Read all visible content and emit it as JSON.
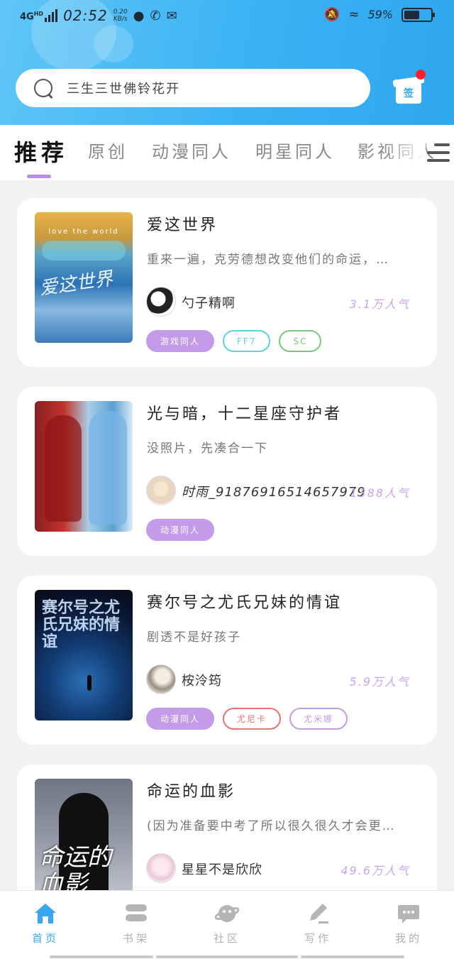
{
  "status_bar": {
    "network": "4G",
    "network_sup": "HD",
    "time": "02:52",
    "speed_value": "0.20",
    "speed_unit": "KB/s",
    "battery": "59%",
    "battery_level": 0.59
  },
  "search": {
    "placeholder": "三生三世佛铃花开"
  },
  "sign_in": {
    "label": "签"
  },
  "tabs": [
    {
      "label": "推荐",
      "active": true
    },
    {
      "label": "原创",
      "active": false
    },
    {
      "label": "动漫同人",
      "active": false
    },
    {
      "label": "明星同人",
      "active": false
    },
    {
      "label": "影视同人",
      "active": false
    }
  ],
  "books": [
    {
      "title": "爱这世界",
      "desc": "重来一遍，克劳德想改变他们的命运，…",
      "author": "勺子精啊",
      "popularity": "3.1万人气",
      "cover_caption": "love the world",
      "cover_text": "爱这世界",
      "tags": [
        {
          "label": "游戏同人",
          "style": "fill",
          "color": "#c39be9"
        },
        {
          "label": "FF7",
          "style": "outline",
          "color": "#5fd0e0"
        },
        {
          "label": "SC",
          "style": "outline",
          "color": "#7bc87a"
        }
      ]
    },
    {
      "title": "光与暗，十二星座守护者",
      "desc": "没照片，先凑合一下",
      "author": "时雨_918769165146579​79",
      "popularity": "1388人气",
      "cover_text": "",
      "tags": [
        {
          "label": "动漫同人",
          "style": "fill",
          "color": "#c39be9"
        }
      ]
    },
    {
      "title": "赛尔号之尤氏兄妹的情谊",
      "desc": "剧透不是好孩子",
      "author": "桉泠筠",
      "popularity": "5.9万人气",
      "cover_text": "赛尔号之尤氏兄妹的情谊",
      "tags": [
        {
          "label": "动漫同人",
          "style": "fill",
          "color": "#c39be9"
        },
        {
          "label": "尤尼卡",
          "style": "outline",
          "color": "#e8736f"
        },
        {
          "label": "尤米娜",
          "style": "outline",
          "color": "#c39be9"
        }
      ]
    },
    {
      "title": "命运的血影",
      "desc": "(因为准备要中考了所以很久很久才会更…",
      "author": "星星不是欣欣",
      "popularity": "49.6万人气",
      "cover_text": "命运的血影",
      "tags": []
    }
  ],
  "bottom_nav": [
    {
      "label": "首页",
      "icon": "home-icon",
      "active": true
    },
    {
      "label": "书架",
      "icon": "bookshelf-icon",
      "active": false
    },
    {
      "label": "社区",
      "icon": "community-icon",
      "active": false
    },
    {
      "label": "写作",
      "icon": "write-icon",
      "active": false
    },
    {
      "label": "我的",
      "icon": "profile-icon",
      "active": false
    }
  ],
  "colors": {
    "header": "#3bb2f3",
    "accent": "#c39be9",
    "nav_active": "#39a6ef"
  }
}
